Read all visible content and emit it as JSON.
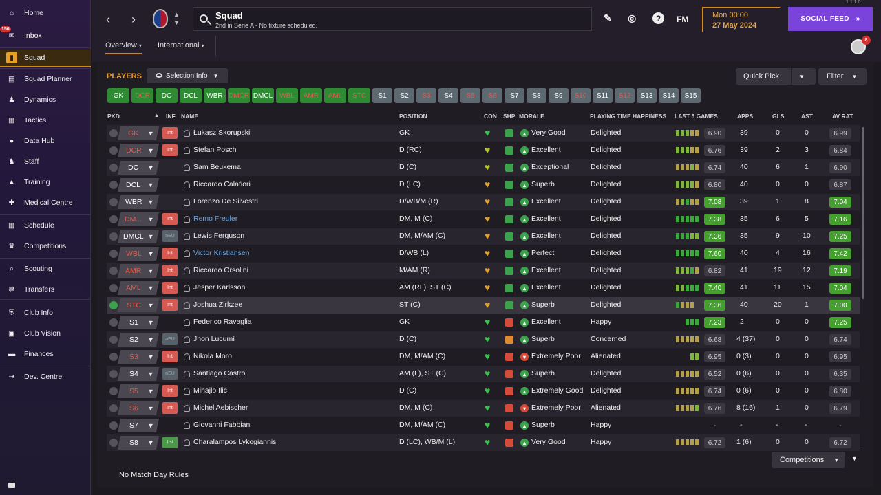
{
  "sidebar": {
    "items": [
      {
        "label": "Home",
        "icon": "home-icon"
      },
      {
        "label": "Inbox",
        "icon": "inbox-icon",
        "badge": "150"
      },
      {
        "label": "Squad",
        "icon": "shirt-icon",
        "active": true
      },
      {
        "label": "Squad Planner",
        "icon": "clipboard-icon"
      },
      {
        "label": "Dynamics",
        "icon": "dynamics-icon"
      },
      {
        "label": "Tactics",
        "icon": "tactics-icon"
      },
      {
        "label": "Data Hub",
        "icon": "data-hub-icon"
      },
      {
        "label": "Staff",
        "icon": "staff-icon"
      },
      {
        "label": "Training",
        "icon": "training-icon"
      },
      {
        "label": "Medical Centre",
        "icon": "medical-icon"
      },
      {
        "label": "Schedule",
        "icon": "schedule-icon"
      },
      {
        "label": "Competitions",
        "icon": "trophy-icon"
      },
      {
        "label": "Scouting",
        "icon": "scouting-icon"
      },
      {
        "label": "Transfers",
        "icon": "transfers-icon"
      },
      {
        "label": "Club Info",
        "icon": "shield-icon"
      },
      {
        "label": "Club Vision",
        "icon": "briefcase-icon"
      },
      {
        "label": "Finances",
        "icon": "finances-icon"
      },
      {
        "label": "Dev. Centre",
        "icon": "dev-centre-icon"
      }
    ]
  },
  "header": {
    "title": "Squad",
    "subtitle": "2nd in Serie A - No fixture scheduled.",
    "time": "Mon 00:00",
    "date": "27 May 2024",
    "social_feed": "SOCIAL FEED",
    "fm_label": "FM",
    "version_hint": "1.1.1.0",
    "avatar_badge": "8",
    "tabs": [
      "Overview",
      "International"
    ]
  },
  "toolbar": {
    "players_title": "PLAYERS",
    "selection_info": "Selection Info",
    "quick_pick": "Quick Pick",
    "filter": "Filter"
  },
  "pills": [
    {
      "l": "GK",
      "c": "g"
    },
    {
      "l": "DCR",
      "c": "gr"
    },
    {
      "l": "DC",
      "c": "g"
    },
    {
      "l": "DCL",
      "c": "g"
    },
    {
      "l": "WBR",
      "c": "g"
    },
    {
      "l": "DMCR",
      "c": "gr"
    },
    {
      "l": "DMCL",
      "c": "g"
    },
    {
      "l": "WBL",
      "c": "gr"
    },
    {
      "l": "AMR",
      "c": "gr"
    },
    {
      "l": "AML",
      "c": "gr"
    },
    {
      "l": "STC",
      "c": "gr"
    },
    {
      "l": "S1",
      "c": "s"
    },
    {
      "l": "S2",
      "c": "s"
    },
    {
      "l": "S3",
      "c": "sr"
    },
    {
      "l": "S4",
      "c": "s"
    },
    {
      "l": "S5",
      "c": "sr"
    },
    {
      "l": "S6",
      "c": "sr"
    },
    {
      "l": "S7",
      "c": "s"
    },
    {
      "l": "S8",
      "c": "s"
    },
    {
      "l": "S9",
      "c": "s"
    },
    {
      "l": "S10",
      "c": "sr"
    },
    {
      "l": "S11",
      "c": "s"
    },
    {
      "l": "S12",
      "c": "sr"
    },
    {
      "l": "S13",
      "c": "s"
    },
    {
      "l": "S14",
      "c": "s"
    },
    {
      "l": "S15",
      "c": "s"
    }
  ],
  "columns": {
    "pkd": "PKD",
    "inf": "INF",
    "name": "NAME",
    "position": "POSITION",
    "con": "CON",
    "shp": "SHP",
    "morale": "MORALE",
    "pth": "PLAYING TIME HAPPINESS",
    "last5": "LAST 5 GAMES",
    "apps": "APPS",
    "gls": "GLS",
    "ast": "AST",
    "avrat": "AV RAT"
  },
  "rows": [
    {
      "pkd": "GK",
      "pk": "r",
      "inf": "Int",
      "name": "Łukasz Skorupski",
      "pos": "GK",
      "con": "green",
      "shp": "green",
      "morale": "Very Good",
      "mc": "#3aa24a",
      "pth": "Delighted",
      "bars": "gggyy",
      "l5": "6.90",
      "l5g": false,
      "apps": "39",
      "gls": "0",
      "ast": "0",
      "avr": "6.99",
      "avg": false
    },
    {
      "pkd": "DCR",
      "pk": "r",
      "inf": "Int",
      "name": "Stefan Posch",
      "pos": "D (RC)",
      "con": "yellowgreen",
      "shp": "green",
      "morale": "Excellent",
      "mc": "#3aa24a",
      "pth": "Delighted",
      "bars": "gggyy",
      "l5": "6.76",
      "l5g": false,
      "apps": "39",
      "gls": "2",
      "ast": "3",
      "avr": "6.84",
      "avg": false
    },
    {
      "pkd": "DC",
      "pk": "w",
      "inf": "",
      "name": "Sam Beukema",
      "pos": "D (C)",
      "con": "yellowgreen",
      "shp": "green",
      "morale": "Exceptional",
      "mc": "#3aa24a",
      "pth": "Delighted",
      "bars": "yyygy",
      "l5": "6.74",
      "l5g": false,
      "apps": "40",
      "gls": "6",
      "ast": "1",
      "avr": "6.90",
      "avg": false
    },
    {
      "pkd": "DCL",
      "pk": "w",
      "inf": "",
      "name": "Riccardo Calafiori",
      "pos": "D (LC)",
      "con": "orange",
      "shp": "green",
      "morale": "Superb",
      "mc": "#3aa24a",
      "pth": "Delighted",
      "bars": "ggggy",
      "l5": "6.80",
      "l5g": false,
      "apps": "40",
      "gls": "0",
      "ast": "0",
      "avr": "6.87",
      "avg": false
    },
    {
      "pkd": "WBR",
      "pk": "w",
      "inf": "",
      "name": "Lorenzo De Silvestri",
      "pos": "D/WB/M (R)",
      "con": "orange",
      "shp": "green",
      "morale": "Excellent",
      "mc": "#3aa24a",
      "pth": "Delighted",
      "bars": "ygGyy",
      "l5": "7.08",
      "l5g": true,
      "apps": "39",
      "gls": "1",
      "ast": "8",
      "avr": "7.04",
      "avg": true
    },
    {
      "pkd": "DM...",
      "pk": "r",
      "inf": "Int",
      "name": "Remo Freuler",
      "link": true,
      "pos": "DM, M (C)",
      "con": "orange",
      "shp": "green",
      "morale": "Excellent",
      "mc": "#3aa24a",
      "pth": "Delighted",
      "bars": "GGGGG",
      "l5": "7.38",
      "l5g": true,
      "apps": "35",
      "gls": "6",
      "ast": "5",
      "avr": "7.16",
      "avg": true
    },
    {
      "pkd": "DMCL",
      "pk": "w",
      "inf": "nEU",
      "name": "Lewis Ferguson",
      "pos": "DM, M/AM (C)",
      "con": "orange",
      "shp": "green",
      "morale": "Excellent",
      "mc": "#3aa24a",
      "pth": "Delighted",
      "bars": "GGGgg",
      "l5": "7.36",
      "l5g": true,
      "apps": "35",
      "gls": "9",
      "ast": "10",
      "avr": "7.25",
      "avg": true
    },
    {
      "pkd": "WBL",
      "pk": "r",
      "inf": "Int",
      "name": "Victor Kristiansen",
      "link": true,
      "pos": "D/WB (L)",
      "con": "orange",
      "shp": "green",
      "morale": "Perfect",
      "mc": "#3aa24a",
      "pth": "Delighted",
      "bars": "GGGGG",
      "l5": "7.60",
      "l5g": true,
      "apps": "40",
      "gls": "4",
      "ast": "16",
      "avr": "7.42",
      "avg": true
    },
    {
      "pkd": "AMR",
      "pk": "r",
      "inf": "Int",
      "name": "Riccardo Orsolini",
      "pos": "M/AM (R)",
      "con": "orange",
      "shp": "green",
      "morale": "Excellent",
      "mc": "#3aa24a",
      "pth": "Delighted",
      "bars": "gggGy",
      "l5": "6.82",
      "l5g": false,
      "apps": "41",
      "gls": "19",
      "ast": "12",
      "avr": "7.19",
      "avg": true
    },
    {
      "pkd": "AML",
      "pk": "r",
      "inf": "Int",
      "name": "Jesper Karlsson",
      "pos": "AM (RL), ST (C)",
      "con": "orange",
      "shp": "green",
      "morale": "Excellent",
      "mc": "#3aa24a",
      "pth": "Delighted",
      "bars": "ggGGG",
      "l5": "7.40",
      "l5g": true,
      "apps": "41",
      "gls": "11",
      "ast": "15",
      "avr": "7.04",
      "avg": true
    },
    {
      "pkd": "STC",
      "pk": "r",
      "inf": "Int",
      "name": "Joshua Zirkzee",
      "pos": "ST (C)",
      "con": "orange",
      "shp": "green",
      "morale": "Superb",
      "mc": "#3aa24a",
      "pth": "Delighted",
      "bars": "Gyyy ",
      "l5": "7.36",
      "l5g": true,
      "apps": "40",
      "gls": "20",
      "ast": "1",
      "avr": "7.00",
      "avg": true,
      "sel": true
    },
    {
      "pkd": "S1",
      "pk": "w",
      "inf": "",
      "name": "Federico Ravaglia",
      "pos": "GK",
      "con": "green",
      "shp": "red",
      "morale": "Excellent",
      "mc": "#3aa24a",
      "pth": "Happy",
      "bars": "  GGG",
      "l5": "7.23",
      "l5g": true,
      "apps": "2",
      "gls": "0",
      "ast": "0",
      "avr": "7.25",
      "avg": true
    },
    {
      "pkd": "S2",
      "pk": "w",
      "inf": "nEU",
      "name": "Jhon Lucumí",
      "pos": "D (C)",
      "con": "green",
      "shp": "orange",
      "morale": "Superb",
      "mc": "#3aa24a",
      "pth": "Concerned",
      "bars": "yyyyy",
      "l5": "6.68",
      "l5g": false,
      "apps": "4 (37)",
      "gls": "0",
      "ast": "0",
      "avr": "6.74",
      "avg": false
    },
    {
      "pkd": "S3",
      "pk": "r",
      "inf": "Int",
      "name": "Nikola Moro",
      "pos": "DM, M/AM (C)",
      "con": "green",
      "shp": "red",
      "morale": "Extremely Poor",
      "mc": "#d64a3a",
      "pth": "Alienated",
      "bars": "   gg",
      "l5": "6.95",
      "l5g": false,
      "apps": "0 (3)",
      "gls": "0",
      "ast": "0",
      "avr": "6.95",
      "avg": false
    },
    {
      "pkd": "S4",
      "pk": "w",
      "inf": "nEU",
      "name": "Santiago Castro",
      "pos": "AM (L), ST (C)",
      "con": "green",
      "shp": "red",
      "morale": "Superb",
      "mc": "#3aa24a",
      "pth": "Delighted",
      "bars": "yyyyy",
      "l5": "6.52",
      "l5g": false,
      "apps": "0 (6)",
      "gls": "0",
      "ast": "0",
      "avr": "6.35",
      "avg": false
    },
    {
      "pkd": "S5",
      "pk": "r",
      "inf": "Int",
      "name": "Mihajlo Ilić",
      "pos": "D (C)",
      "con": "green",
      "shp": "red",
      "morale": "Extremely Good",
      "mc": "#3aa24a",
      "pth": "Delighted",
      "bars": "yyyyy",
      "l5": "6.74",
      "l5g": false,
      "apps": "0 (6)",
      "gls": "0",
      "ast": "0",
      "avr": "6.80",
      "avg": false
    },
    {
      "pkd": "S6",
      "pk": "r",
      "inf": "Int",
      "name": "Michel Aebischer",
      "pos": "DM, M (C)",
      "con": "green",
      "shp": "red",
      "morale": "Extremely Poor",
      "mc": "#d64a3a",
      "pth": "Alienated",
      "bars": "yyyyg",
      "l5": "6.76",
      "l5g": false,
      "apps": "8 (16)",
      "gls": "1",
      "ast": "0",
      "avr": "6.79",
      "avg": false
    },
    {
      "pkd": "S7",
      "pk": "w",
      "inf": "",
      "name": "Giovanni Fabbian",
      "pos": "DM, M/AM (C)",
      "con": "green",
      "shp": "red",
      "morale": "Superb",
      "mc": "#3aa24a",
      "pth": "Happy",
      "bars": "     ",
      "l5": "-",
      "l5g": false,
      "apps": "-",
      "gls": "-",
      "ast": "-",
      "avr": "-",
      "avg": false,
      "none": true
    },
    {
      "pkd": "S8",
      "pk": "w",
      "inf": "Lst",
      "name": "Charalampos Lykogiannis",
      "pos": "D (LC), WB/M (L)",
      "con": "green",
      "shp": "red",
      "morale": "Very Good",
      "mc": "#3aa24a",
      "pth": "Happy",
      "bars": "yyyyy",
      "l5": "6.72",
      "l5g": false,
      "apps": "1 (6)",
      "gls": "0",
      "ast": "0",
      "avr": "6.72",
      "avg": false
    }
  ],
  "footer": {
    "competitions": "Competitions",
    "match_day_rules": "No Match Day Rules"
  },
  "colors": {
    "accent": "#d08a1a",
    "social": "#7a43d9",
    "good": "#45a030",
    "bad": "#d65a52"
  }
}
